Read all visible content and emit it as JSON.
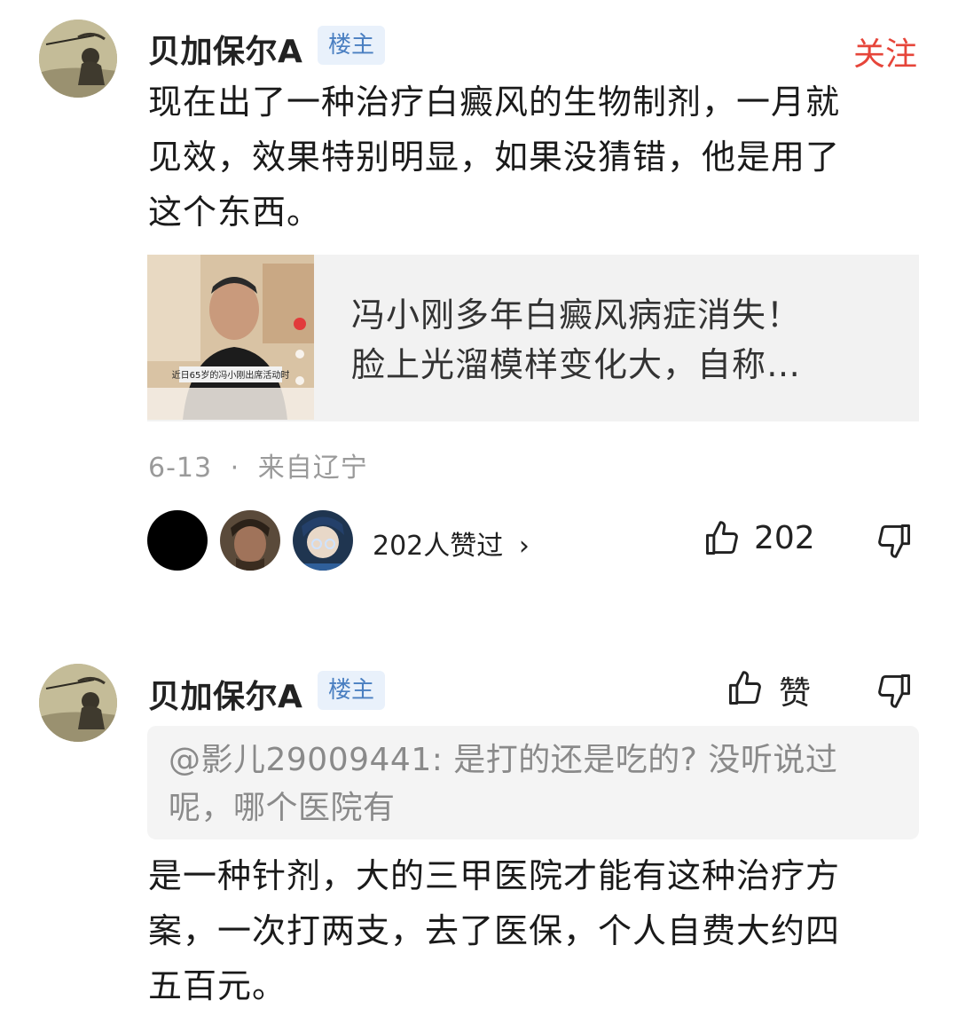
{
  "post": {
    "author": "贝加保尔A",
    "badge": "楼主",
    "follow_label": "关注",
    "content_lines": [
      "现在出了一种治疗白癜风的生物制剂，一月就",
      "见效，效果特别明显，如果没猜错，他是用了",
      "这个东西。"
    ],
    "card": {
      "caption": "近日65岁的冯小刚出席活动时",
      "title_lines": [
        "冯小刚多年白癜风病症消失！",
        "脸上光溜模样变化大，自称…"
      ]
    },
    "date": "6-13",
    "separator": "·",
    "location": "来自辽宁",
    "likers_text": "202人赞过",
    "likers_arrow": "›",
    "like_count": "202"
  },
  "reply": {
    "author": "贝加保尔A",
    "badge": "楼主",
    "like_label": "赞",
    "quote_lines": [
      "@影儿29009441: 是打的还是吃的? 没听说过",
      "呢，哪个医院有"
    ],
    "content_lines": [
      "是一种针剂，大的三甲医院才能有这种治疗方",
      "案，一次打两支，去了医保，个人自费大约四",
      "五百元。"
    ]
  },
  "colors": {
    "follow": "#e6453a",
    "badge_text": "#4a7fc1",
    "badge_bg": "#e9f1fb",
    "meta": "#9a9a9a"
  }
}
